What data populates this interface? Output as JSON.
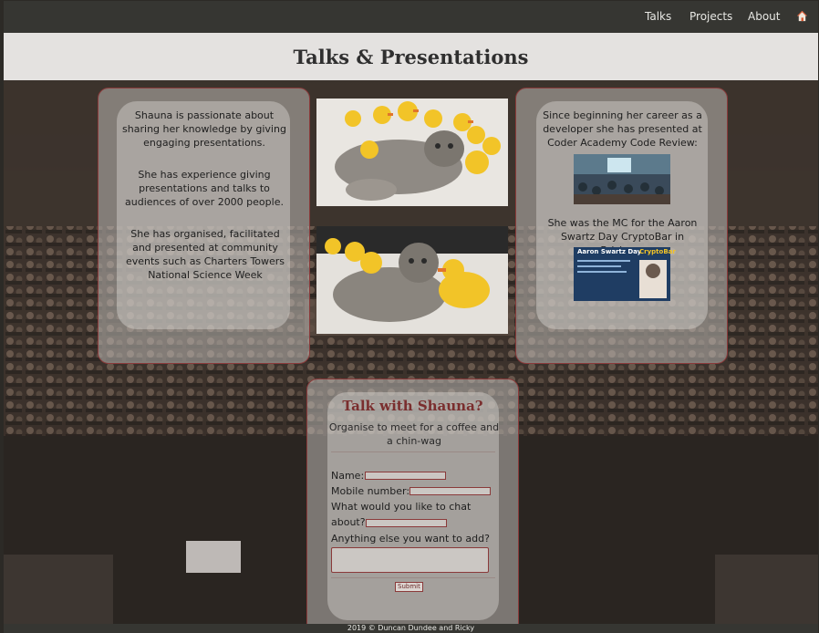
{
  "nav": {
    "items": [
      "Talks",
      "Projects",
      "About"
    ],
    "home_icon": "home-icon"
  },
  "header": {
    "title": "Talks & Presentations"
  },
  "left_card": {
    "p1": "Shauna is passionate about sharing her knowledge by giving engaging presentations.",
    "p2": "She has experience giving presentations and talks to audiences of over 2000 people.",
    "p3": "She has organised, facilitated and presented at community events such as Charters Towers National Science Week"
  },
  "right_card": {
    "p1": "Since beginning her career as a developer she has presented at Coder Academy Code Review:",
    "p2": "She was the MC for the Aaron Swartz Day CryptoBar in Brisbane",
    "poster_title": "Aaron Swartz Day",
    "poster_badge": "CryptoBar"
  },
  "form": {
    "title": "Talk with Shauna?",
    "subtitle": "Organise to meet for a coffee and a chin-wag",
    "name_label": "Name:",
    "mobile_label": "Mobile number:",
    "chat_label_line1": "What would you like to chat",
    "chat_label_line2": "about?",
    "extra_label": "Anything else you want to add?",
    "name_value": "",
    "mobile_value": "",
    "chat_value": "",
    "extra_value": "",
    "submit_label": "Submit"
  },
  "footer": {
    "text": "2019 © Duncan Dundee and Ricky"
  },
  "colors": {
    "nav_bg": "#363632",
    "header_bg": "#e4e2e0",
    "accent": "#8a3a3a"
  }
}
